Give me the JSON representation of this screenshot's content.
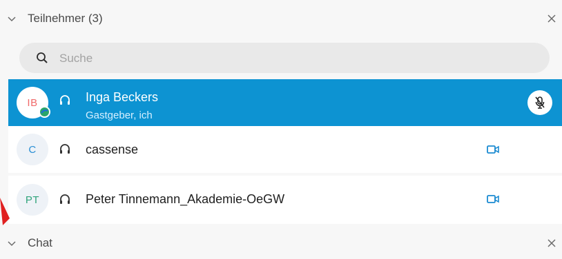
{
  "participants_section": {
    "title": "Teilnehmer (3)",
    "search_placeholder": "Suche"
  },
  "participants": [
    {
      "initials": "IB",
      "name": "Inga Beckers",
      "role": "Gastgeber, ich",
      "selected": true,
      "audio": "headset",
      "muted": true
    },
    {
      "initials": "C",
      "name": "cassense",
      "video": true
    },
    {
      "initials": "PT",
      "name": "Peter Tinnemann_Akademie-OeGW",
      "video": true
    }
  ],
  "chat_section": {
    "title": "Chat"
  },
  "colors": {
    "selected_bg": "#0d93d2",
    "video_icon": "#1a8ad1",
    "avatar_ib": "#f06a6a",
    "avatar_c": "#2a8fd4",
    "avatar_pt": "#2fa37a",
    "annotation_arrow": "#e02020"
  }
}
